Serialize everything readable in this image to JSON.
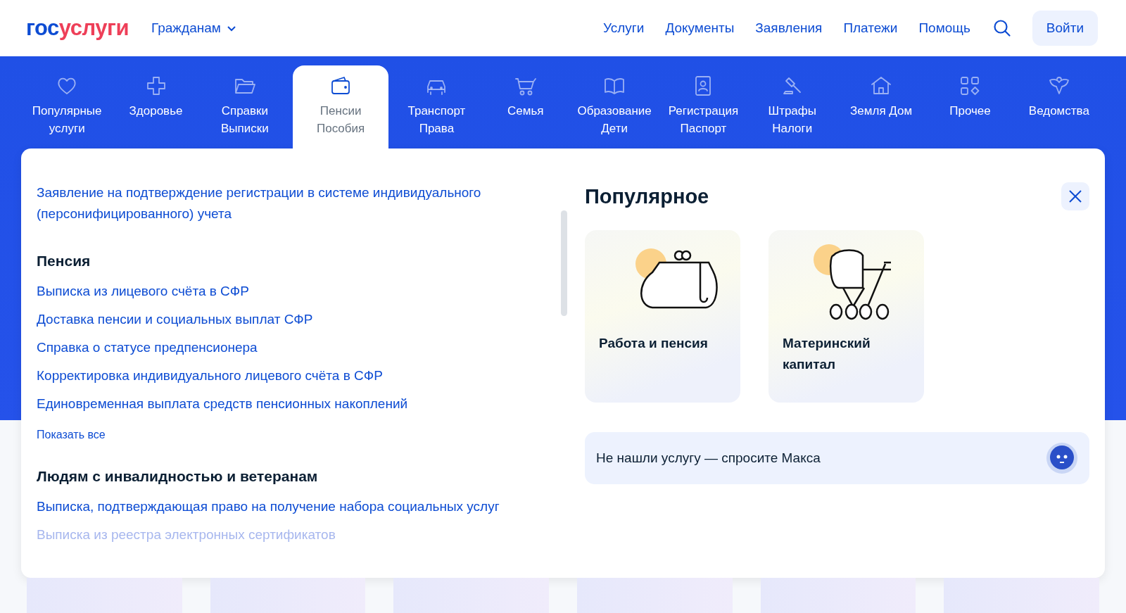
{
  "header": {
    "logo": {
      "part1": "гос",
      "part2": "услуги"
    },
    "audience": "Гражданам",
    "nav": [
      "Услуги",
      "Документы",
      "Заявления",
      "Платежи",
      "Помощь"
    ],
    "login": "Войти"
  },
  "categories": [
    {
      "label": "Популярные\nуслуги",
      "selected": false
    },
    {
      "label": "Здоровье",
      "selected": false
    },
    {
      "label": "Справки\nВыписки",
      "selected": false
    },
    {
      "label": "Пенсии\nПособия",
      "selected": true
    },
    {
      "label": "Транспорт\nПрава",
      "selected": false
    },
    {
      "label": "Семья",
      "selected": false
    },
    {
      "label": "Образование\nДети",
      "selected": false
    },
    {
      "label": "Регистрация\nПаспорт",
      "selected": false
    },
    {
      "label": "Штрафы\nНалоги",
      "selected": false
    },
    {
      "label": "Земля Дом",
      "selected": false
    },
    {
      "label": "Прочее",
      "selected": false
    },
    {
      "label": "Ведомства",
      "selected": false
    }
  ],
  "services": {
    "sections": [
      {
        "items": [
          {
            "text": "Заявление на подтверждение регистрации в системе индивидуального (персонифицированного) учета",
            "faded": false
          }
        ]
      },
      {
        "title": "Пенсия",
        "items": [
          {
            "text": "Выписка из лицевого счёта в СФР",
            "faded": false
          },
          {
            "text": "Доставка пенсии и социальных выплат СФР",
            "faded": false
          },
          {
            "text": "Справка о статусе предпенсионера",
            "faded": false
          },
          {
            "text": "Корректировка индивидуального лицевого счёта в СФР",
            "faded": false
          },
          {
            "text": "Единовременная выплата средств пенсионных накоплений",
            "faded": false
          }
        ],
        "show_all": "Показать все"
      },
      {
        "title": "Людям с инвалидностью и ветеранам",
        "items": [
          {
            "text": "Выписка, подтверждающая право на получение набора социальных услуг",
            "faded": false
          },
          {
            "text": "Выписка из реестра электронных сертификатов",
            "faded": true
          }
        ]
      }
    ]
  },
  "popular": {
    "title": "Популярное",
    "cards": [
      {
        "title": "Работа и пенсия",
        "kind": "purse"
      },
      {
        "title": "Материнский капитал",
        "kind": "stroller"
      }
    ],
    "ask": "Не нашли услугу — спросите Макса"
  }
}
